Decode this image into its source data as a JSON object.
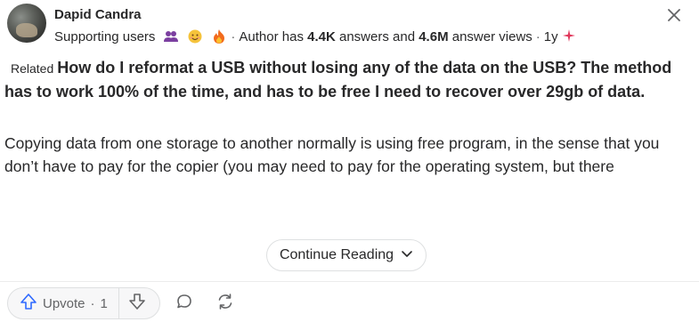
{
  "author": {
    "name": "Dapid Candra",
    "supporting_label": "Supporting users",
    "stats_prefix": "Author has",
    "answers_count": "4.4K",
    "answers_label": "answers and",
    "views_count": "4.6M",
    "views_label": "answer views",
    "separator": "·",
    "age": "1y"
  },
  "question": {
    "related_label": "Related",
    "text": "How do I reformat a USB without losing any of the data on the USB? The method has to work 100% of the time, and has to be free I need to recover over 29gb of data."
  },
  "answer": {
    "body": "Copying data from one storage to another normally is using free program, in the sense that you don’t have to pay for the copier (you may need to pay for the operating system, but there"
  },
  "continue_label": "Continue Reading",
  "actions": {
    "upvote_label": "Upvote",
    "upvote_sep": "·",
    "upvote_count": "1"
  },
  "colors": {
    "accent": "#2e69ff",
    "text": "#282829",
    "muted": "#636466",
    "spark": "#e0365a"
  }
}
